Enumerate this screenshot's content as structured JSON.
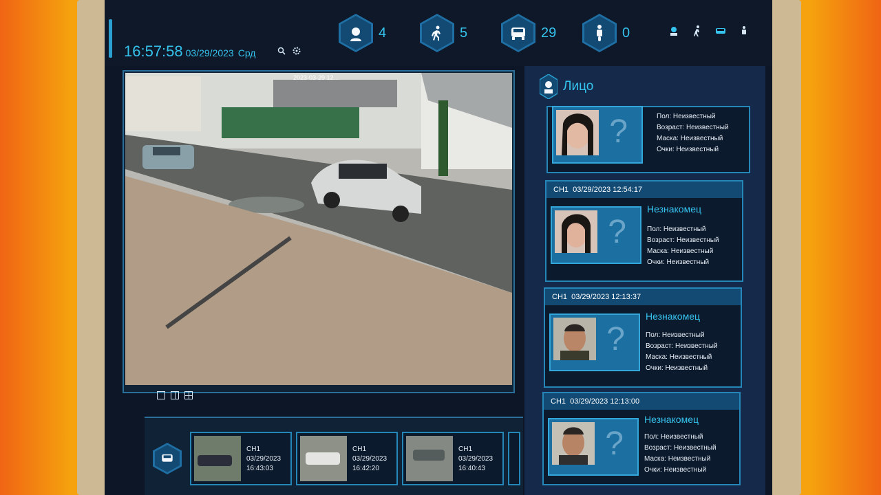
{
  "app": {
    "time": "16:57:58",
    "date": "03/29/2023",
    "day": "Срд",
    "icons": {
      "search": "search-icon",
      "settings": "gear-icon"
    }
  },
  "counters": [
    {
      "name": "face",
      "icon": "face-icon",
      "value": "4"
    },
    {
      "name": "person",
      "icon": "walking-person-icon",
      "value": "5"
    },
    {
      "name": "vehicle",
      "icon": "car-icon",
      "value": "29"
    },
    {
      "name": "motorbike",
      "icon": "motorbike-icon",
      "value": "0"
    }
  ],
  "filters": [
    {
      "icon": "face-filter-icon"
    },
    {
      "icon": "person-filter-icon"
    },
    {
      "icon": "car-filter-icon"
    },
    {
      "icon": "bike-filter-icon"
    }
  ],
  "video": {
    "overlay_timestamp": "2023-03-29 12..."
  },
  "thumbnails": [
    {
      "channel": "CH1",
      "date": "03/29/2023",
      "time": "16:43:03"
    },
    {
      "channel": "CH1",
      "date": "03/29/2023",
      "time": "16:42:20"
    },
    {
      "channel": "CH1",
      "date": "03/29/2023",
      "time": "16:40:43"
    }
  ],
  "side": {
    "title": "Лицо",
    "cards": [
      {
        "channel": "",
        "timestamp": "",
        "label": "",
        "gender": "Пол: Неизвестный",
        "age": "Возраст: Неизвестный",
        "mask": "Маска: Неизвестный",
        "glasses": "Очки: Неизвестный"
      },
      {
        "channel": "CH1",
        "timestamp": "03/29/2023 12:54:17",
        "label": "Незнакомец",
        "gender": "Пол: Неизвестный",
        "age": "Возраст: Неизвестный",
        "mask": "Маска: Неизвестный",
        "glasses": "Очки: Неизвестный"
      },
      {
        "channel": "CH1",
        "timestamp": "03/29/2023 12:13:37",
        "label": "Незнакомец",
        "gender": "Пол: Неизвестный",
        "age": "Возраст: Неизвестный",
        "mask": "Маска: Неизвестный",
        "glasses": "Очки: Неизвестный"
      },
      {
        "channel": "CH1",
        "timestamp": "03/29/2023 12:13:00",
        "label": "Незнакомец",
        "gender": "Пол: Неизвестный",
        "age": "Возраст: Неизвестный",
        "mask": "Маска: Неизвестный",
        "glasses": "Очки: Неизвестный"
      }
    ]
  }
}
